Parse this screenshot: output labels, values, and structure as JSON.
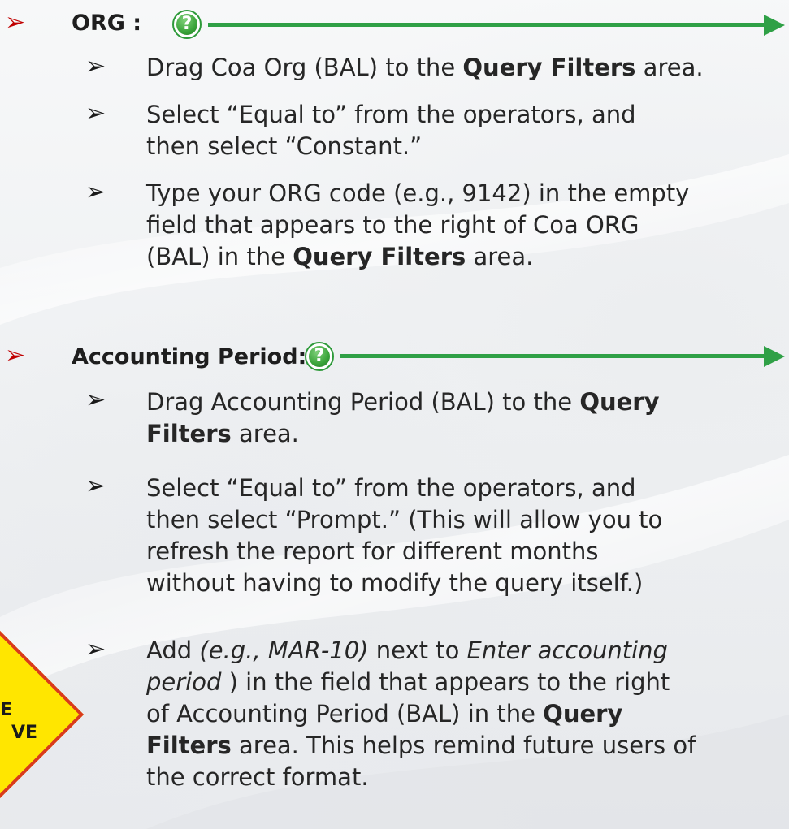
{
  "sections": [
    {
      "heading": "ORG :",
      "help": "?",
      "bullets": [
        [
          "Drag Coa Org (BAL) to the ",
          {
            "b": "Query Filters"
          },
          " area."
        ],
        [
          "Select “Equal to” from the operators, and",
          "\n",
          "then  select “Constant.”"
        ],
        [
          "Type your ORG code (e.g., 9142) in the empty",
          "\n",
          "field that appears to the right of Coa ORG",
          "\n",
          "(BAL) in the ",
          {
            "b": "Query Filters"
          },
          " area."
        ]
      ]
    },
    {
      "heading": "Accounting  Period:",
      "help": "?",
      "bullets": [
        [
          "Drag Accounting Period (BAL) to the ",
          {
            "b": "Query"
          },
          "\n",
          {
            "b": "Filters"
          },
          " area."
        ],
        [
          "Select “Equal to” from the operators, and",
          "\n",
          "then  select “Prompt.” (This will allow you to",
          "\n",
          "refresh the report for different months",
          "\n",
          "without having to modify the query itself.)"
        ],
        [
          "Add ",
          {
            "i": "(e.g., MAR-10)"
          },
          " next to  ",
          {
            "i": "Enter accounting"
          },
          "\n",
          {
            "i": "period"
          },
          " ) in the field that appears to the right",
          "\n",
          "of Accounting Period (BAL) in the ",
          {
            "b": "Query"
          },
          "\n",
          {
            "b": "Filters"
          },
          " area. This helps remind future users of",
          "\n",
          "the correct format."
        ]
      ]
    }
  ],
  "warning_sign": {
    "line1": "E",
    "line2": "VE"
  },
  "glyphs": {
    "main_bullet": "➢",
    "sub_bullet": "➢"
  },
  "colors": {
    "accent_green": "#2fa046",
    "bullet_red": "#c00000",
    "sign_yellow": "#ffe600",
    "sign_border": "#d93a1c"
  },
  "icons": {
    "help": "question-circle-icon",
    "connector": "right-arrow-line"
  }
}
